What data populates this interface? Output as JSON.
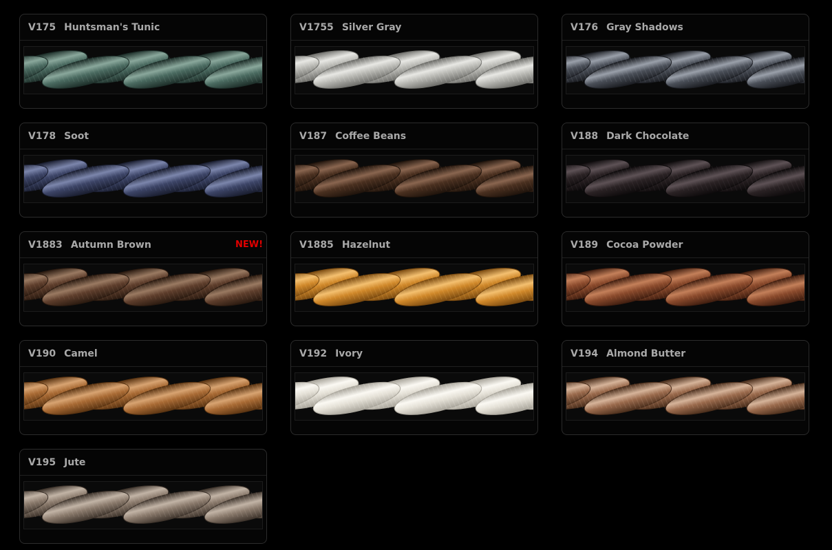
{
  "threads": [
    {
      "code": "V175",
      "name": "Huntsman's Tunic",
      "badge": "",
      "color": "#4a6a60",
      "dark": "#1e2f2a",
      "light": "#8aa89c"
    },
    {
      "code": "V1755",
      "name": "Silver Gray",
      "badge": "",
      "color": "#b9b9b4",
      "dark": "#6e6e6a",
      "light": "#e8e8e4"
    },
    {
      "code": "V176",
      "name": "Gray Shadows",
      "badge": "",
      "color": "#4a4f58",
      "dark": "#1b1d22",
      "light": "#9aa0aa"
    },
    {
      "code": "V178",
      "name": "Soot",
      "badge": "",
      "color": "#3c4466",
      "dark": "#1a1e30",
      "light": "#7c86ac"
    },
    {
      "code": "V187",
      "name": "Coffee Beans",
      "badge": "",
      "color": "#4a3020",
      "dark": "#20140c",
      "light": "#8a6650"
    },
    {
      "code": "V188",
      "name": "Dark Chocolate",
      "badge": "",
      "color": "#2a2224",
      "dark": "#0e0b0c",
      "light": "#5e5256"
    },
    {
      "code": "V1883",
      "name": "Autumn Brown",
      "badge": "NEW!",
      "color": "#5e3e2c",
      "dark": "#2a1a10",
      "light": "#9a7a62"
    },
    {
      "code": "V1885",
      "name": "Hazelnut",
      "badge": "",
      "color": "#d0882a",
      "dark": "#7a4a10",
      "light": "#f4c070"
    },
    {
      "code": "V189",
      "name": "Cocoa Powder",
      "badge": "",
      "color": "#8a4a2c",
      "dark": "#401e10",
      "light": "#c4805a"
    },
    {
      "code": "V190",
      "name": "Camel",
      "badge": "",
      "color": "#a86a34",
      "dark": "#5a3412",
      "light": "#d8a472"
    },
    {
      "code": "V192",
      "name": "Ivory",
      "badge": "",
      "color": "#e4e0d6",
      "dark": "#a8a49a",
      "light": "#fbf9f3"
    },
    {
      "code": "V194",
      "name": "Almond Butter",
      "badge": "",
      "color": "#9a6a4c",
      "dark": "#4a2e1c",
      "light": "#d6b49a"
    },
    {
      "code": "V195",
      "name": "Jute",
      "badge": "",
      "color": "#8a7a6c",
      "dark": "#3e342c",
      "light": "#c2b4a6"
    }
  ]
}
